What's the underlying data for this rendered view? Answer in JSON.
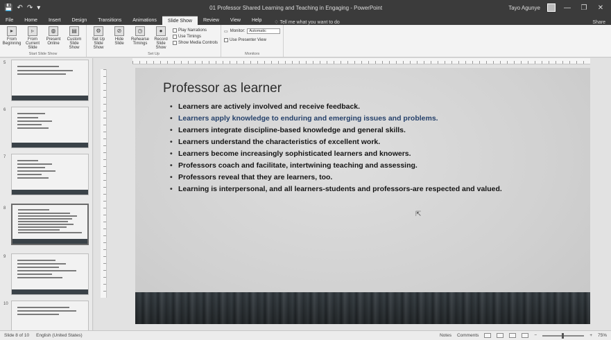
{
  "titlebar": {
    "quick_access": [
      "💾",
      "↶",
      "↷",
      "▾"
    ],
    "title": "01 Professor Shared Learning and Teaching in Engaging - PowerPoint",
    "user": "Tayo Agunye",
    "buttons": [
      "—",
      "❐",
      "✕"
    ]
  },
  "tabs": [
    {
      "label": "File"
    },
    {
      "label": "Home"
    },
    {
      "label": "Insert"
    },
    {
      "label": "Design"
    },
    {
      "label": "Transitions"
    },
    {
      "label": "Animations"
    },
    {
      "label": "Slide Show",
      "active": true
    },
    {
      "label": "Review"
    },
    {
      "label": "View"
    },
    {
      "label": "Help"
    }
  ],
  "tell_me": "Tell me what you want to do",
  "share": "Share",
  "ribbon": {
    "start_group": {
      "buttons": [
        "From Beginning",
        "From Current Slide",
        "Present Online",
        "Custom Slide Show"
      ],
      "label": "Start Slide Show"
    },
    "setup_group": {
      "buttons": [
        "Set Up Slide Show",
        "Hide Slide",
        "Rehearse Timings",
        "Record Slide Show"
      ],
      "checks": [
        "Play Narrations",
        "Use Timings",
        "Show Media Controls"
      ],
      "label": "Set Up"
    },
    "monitors_group": {
      "monitor_label": "Monitor:",
      "monitor_value": "Automatic",
      "presenter_view": "Use Presenter View",
      "label": "Monitors"
    }
  },
  "slide": {
    "title": "Professor as learner",
    "bullets": [
      {
        "text": "Learners are actively involved and receive feedback.",
        "accent": false
      },
      {
        "text": "Learners apply knowledge to enduring and emerging issues and problems.",
        "accent": true
      },
      {
        "text": "Learners integrate discipline-based knowledge and general skills.",
        "accent": false
      },
      {
        "text": "Learners understand the characteristics of excellent work.",
        "accent": false
      },
      {
        "text": "Learners become increasingly sophisticated learners and knowers.",
        "accent": false
      },
      {
        "text": "Professors coach and facilitate, intertwining teaching and assessing.",
        "accent": false
      },
      {
        "text": "Professors reveal that they are learners, too.",
        "accent": false
      },
      {
        "text": "Learning is interpersonal, and all learners-students and professors-are respected and valued.",
        "accent": false
      }
    ]
  },
  "thumbnails": [
    {
      "number": "5"
    },
    {
      "number": "6"
    },
    {
      "number": "7"
    },
    {
      "number": "8"
    },
    {
      "number": "9"
    },
    {
      "number": "10"
    }
  ],
  "statusbar": {
    "slide_info": "Slide 8 of 10",
    "language": "English (United States)",
    "notes": "Notes",
    "comments": "Comments",
    "zoom": "75%"
  }
}
